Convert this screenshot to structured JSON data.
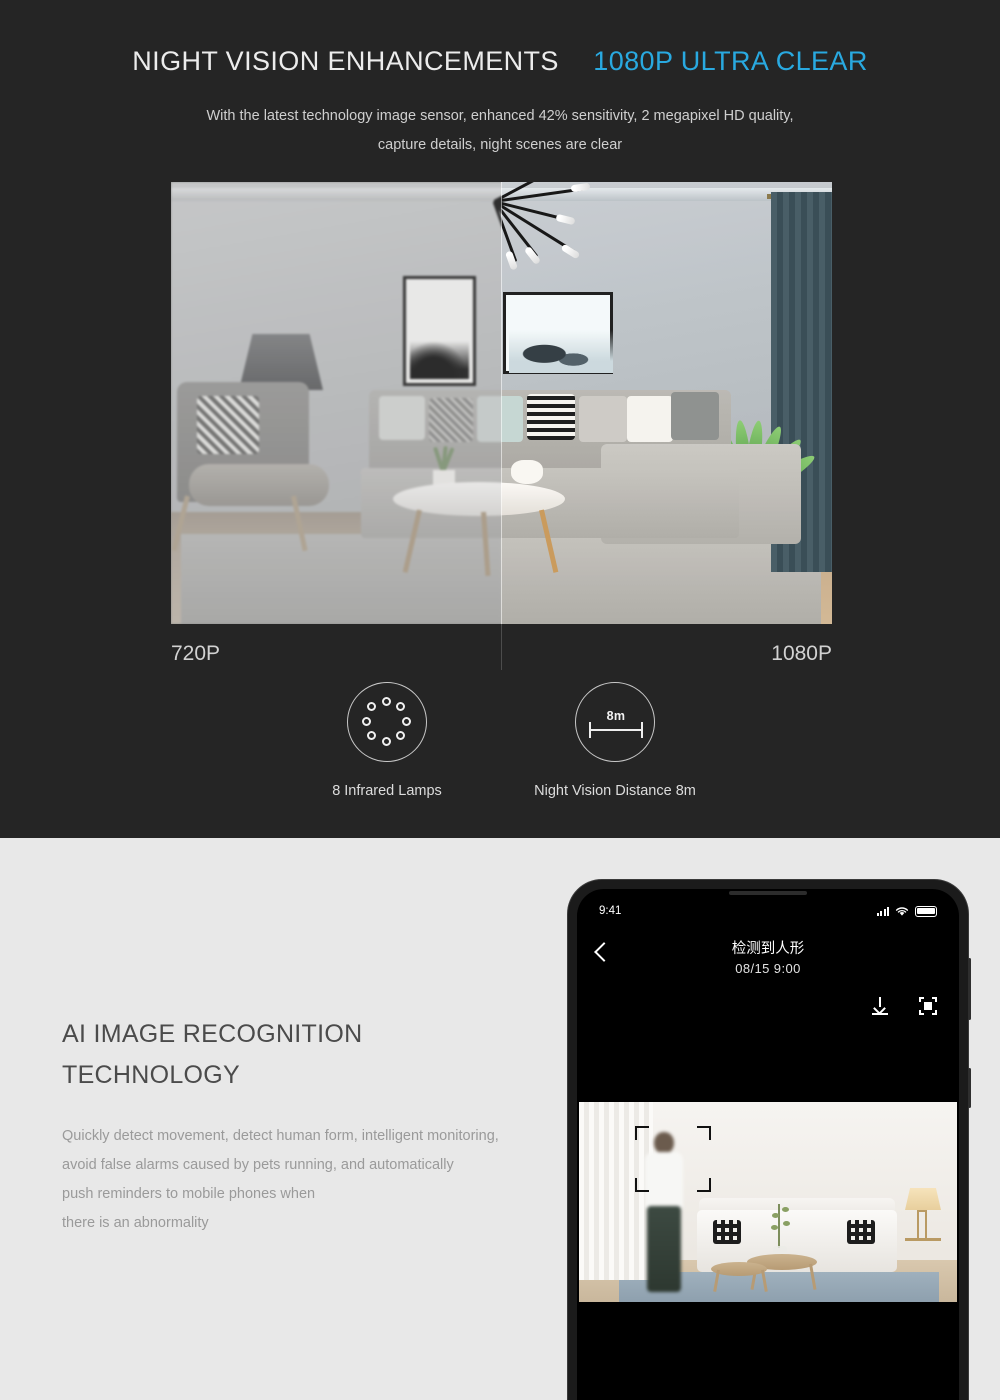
{
  "section_night_vision": {
    "headline_main": "NIGHT VISION ENHANCEMENTS",
    "headline_accent": "1080P ULTRA CLEAR",
    "accent_color": "#29a9e0",
    "background_color": "#252525",
    "subtitle_line1": "With the latest technology image sensor, enhanced 42% sensitivity, 2 megapixel HD quality,",
    "subtitle_line2": "capture details, night scenes are clear",
    "comparison": {
      "left_label": "720P",
      "right_label": "1080P"
    },
    "features": [
      {
        "icon": "infrared-lamps-icon",
        "label": "8 Infrared Lamps",
        "count": 8
      },
      {
        "icon": "night-vision-distance-icon",
        "label": "Night Vision Distance 8m",
        "badge": "8m"
      }
    ]
  },
  "section_ai": {
    "background_color": "#e8e8e8",
    "title_line1": "AI IMAGE RECOGNITION",
    "title_line2": "TECHNOLOGY",
    "body_line1": "Quickly detect movement, detect human form, intelligent monitoring,",
    "body_line2": "avoid false alarms caused by pets running, and automatically",
    "body_line3": "push reminders to mobile phones when",
    "body_line4": "there is an abnormality",
    "phone": {
      "status_time": "9:41",
      "status_icons": [
        "signal-icon",
        "wifi-icon",
        "battery-icon"
      ],
      "back_icon": "back-chevron-icon",
      "nav_title": "检测到人形",
      "nav_date": "08/15  9:00",
      "toolbar_icons": [
        "download-icon",
        "snapshot-icon"
      ]
    }
  }
}
